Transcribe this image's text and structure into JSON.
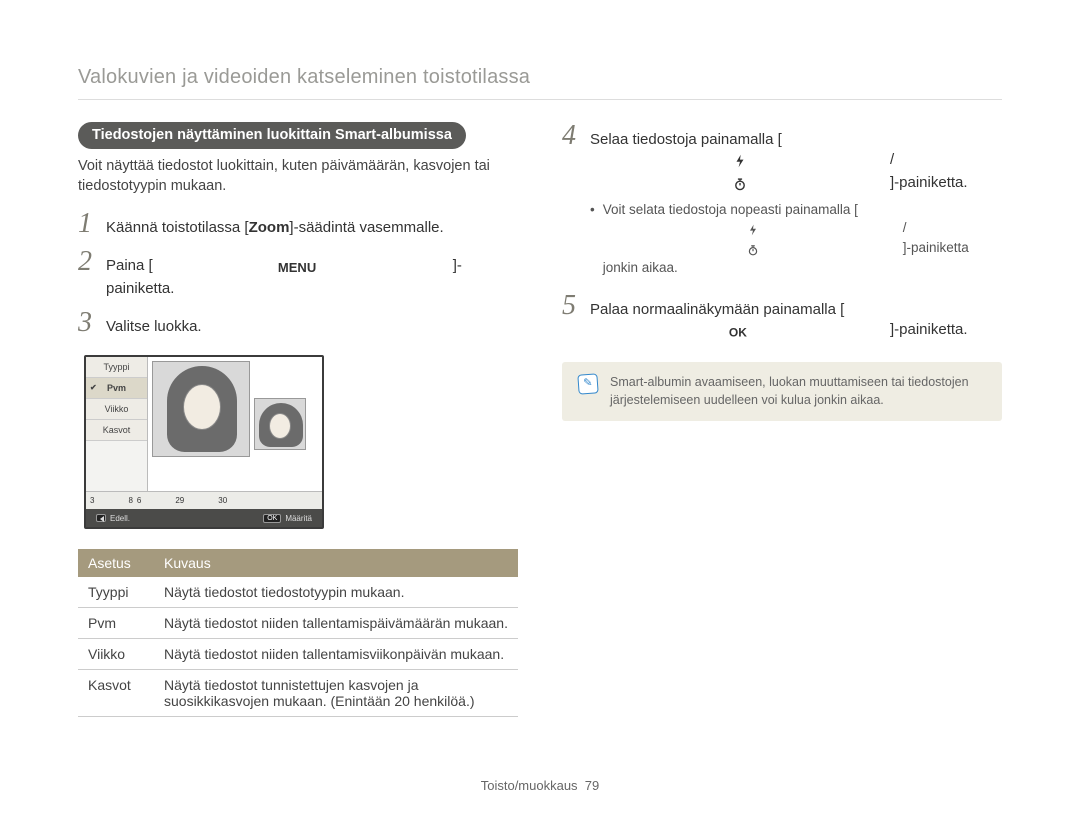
{
  "page_title": "Valokuvien ja videoiden katseleminen toistotilassa",
  "pill_title": "Tiedostojen näyttäminen luokittain Smart-albumissa",
  "intro": "Voit näyttää tiedostot luokittain, kuten päivämäärän, kasvojen tai tiedostotyypin mukaan.",
  "left_steps": [
    {
      "num": "1",
      "pre": "Käännä toistotilassa [",
      "bold": "Zoom",
      "post": "]-säädintä vasemmalle."
    },
    {
      "num": "2",
      "pre": "Paina [",
      "icon": "menu",
      "post": "]-painiketta."
    },
    {
      "num": "3",
      "pre": "Valitse luokka.",
      "post": ""
    }
  ],
  "device_menu": {
    "items": [
      "Tyyppi",
      "Pvm",
      "Viikko",
      "Kasvot"
    ],
    "selected_index": 1,
    "timeline_ticks": [
      "3",
      "8",
      "6",
      "29",
      "30"
    ],
    "footer": {
      "back": "Edell.",
      "back_key": "◄",
      "set": "Määritä",
      "set_key": "OK"
    }
  },
  "settings_table": {
    "headers": [
      "Asetus",
      "Kuvaus"
    ],
    "rows": [
      [
        "Tyyppi",
        "Näytä tiedostot tiedostotyypin mukaan."
      ],
      [
        "Pvm",
        "Näytä tiedostot niiden tallentamispäivämäärän mukaan."
      ],
      [
        "Viikko",
        "Näytä tiedostot niiden tallentamisviikonpäivän mukaan."
      ],
      [
        "Kasvot",
        "Näytä tiedostot tunnistettujen kasvojen ja suosikkikasvojen mukaan. (Enintään 20 henkilöä.)"
      ]
    ]
  },
  "right_steps": {
    "s4_pre": "Selaa tiedostoja painamalla [",
    "s4_post": "]-painiketta.",
    "s4_sub_pre": "Voit selata tiedostoja nopeasti painamalla [",
    "s4_sub_post": "]-painiketta jonkin aikaa.",
    "s5_pre": "Palaa normaalinäkymään painamalla [",
    "s5_post": "]-painiketta."
  },
  "icons": {
    "flash": "flash-icon",
    "timer": "timer-icon",
    "menu": "menu-icon",
    "ok": "ok-icon"
  },
  "note_text": "Smart-albumin avaamiseen, luokan muuttamiseen tai tiedostojen järjestelemiseen uudelleen voi kulua jonkin aikaa.",
  "footer_section": "Toisto/muokkaus",
  "footer_page": "79"
}
